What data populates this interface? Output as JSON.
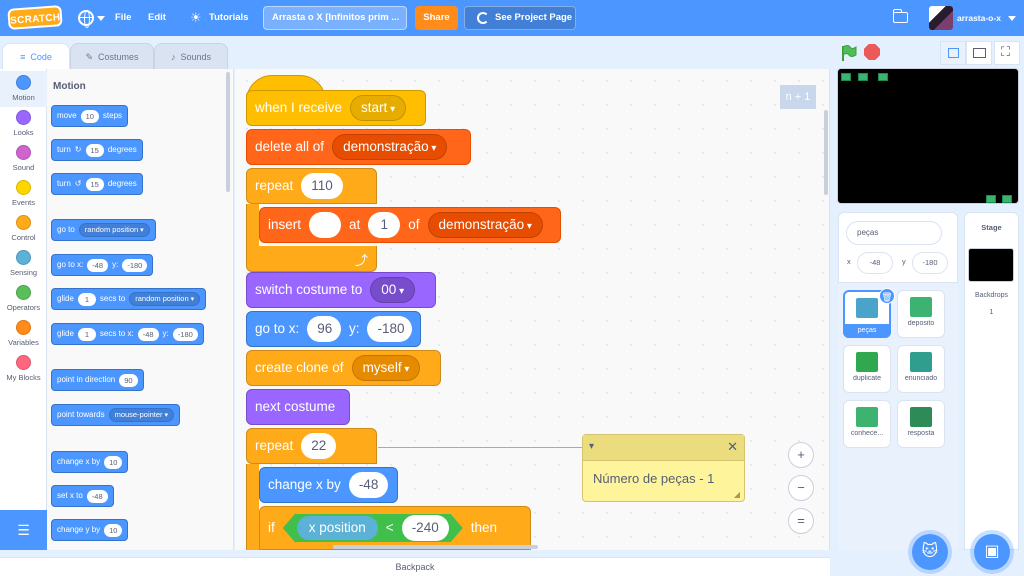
{
  "menubar": {
    "logo": "SCRATCH",
    "file": "File",
    "edit": "Edit",
    "tutorials": "Tutorials",
    "project_title": "Arrasta o X [Infinitos prim ...",
    "share": "Share",
    "see_project_page": "See Project Page",
    "username": "arrasta-o-x"
  },
  "tabs": {
    "code": "Code",
    "costumes": "Costumes",
    "sounds": "Sounds"
  },
  "categories": [
    {
      "label": "Motion",
      "color": "#4c97ff"
    },
    {
      "label": "Looks",
      "color": "#9966ff"
    },
    {
      "label": "Sound",
      "color": "#cf63cf"
    },
    {
      "label": "Events",
      "color": "#ffd500"
    },
    {
      "label": "Control",
      "color": "#ffab19"
    },
    {
      "label": "Sensing",
      "color": "#5cb1d6"
    },
    {
      "label": "Operators",
      "color": "#59c059"
    },
    {
      "label": "Variables",
      "color": "#ff8c1a"
    },
    {
      "label": "My Blocks",
      "color": "#ff6680"
    }
  ],
  "flyout": {
    "title": "Motion",
    "move": {
      "a": "move",
      "v": "10",
      "b": "steps"
    },
    "turn_right": {
      "a": "turn",
      "v": "15",
      "b": "degrees"
    },
    "turn_left": {
      "a": "turn",
      "v": "15",
      "b": "degrees"
    },
    "goto": {
      "a": "go to",
      "dd": "random position"
    },
    "goto_xy": {
      "a": "go to x:",
      "x": "-48",
      "b": "y:",
      "y": "-180"
    },
    "glide_to": {
      "a": "glide",
      "v": "1",
      "b": "secs to",
      "dd": "random position"
    },
    "glide_xy": {
      "a": "glide",
      "v": "1",
      "b": "secs to x:",
      "x": "-48",
      "c": "y:",
      "y": "-180"
    },
    "point_dir": {
      "a": "point in direction",
      "v": "90"
    },
    "point_towards": {
      "a": "point towards",
      "dd": "mouse-pointer"
    },
    "change_x": {
      "a": "change x by",
      "v": "10"
    },
    "set_x": {
      "a": "set x to",
      "v": "-48"
    },
    "change_y": {
      "a": "change y by",
      "v": "10"
    }
  },
  "script": {
    "when_receive": {
      "a": "when I receive",
      "dd": "start"
    },
    "delete_all": {
      "a": "delete all of",
      "dd": "demonstração"
    },
    "repeat1": {
      "a": "repeat",
      "v": "110"
    },
    "insert": {
      "a": "insert",
      "v1": "",
      "b": "at",
      "v2": "1",
      "c": "of",
      "dd": "demonstração"
    },
    "switch_costume": {
      "a": "switch costume to",
      "dd": "00"
    },
    "goto_xy": {
      "a": "go to x:",
      "x": "96",
      "b": "y:",
      "y": "-180"
    },
    "create_clone": {
      "a": "create clone of",
      "dd": "myself"
    },
    "next_costume": "next costume",
    "repeat2": {
      "a": "repeat",
      "v": "22"
    },
    "change_x": {
      "a": "change x by",
      "v": "-48"
    },
    "if_block": {
      "a": "if",
      "rep": "x position",
      "op": "<",
      "v": "-240",
      "b": "then"
    },
    "ghost_label": "n + 1"
  },
  "comment": {
    "text": "Número de peças - 1"
  },
  "zoom": {
    "in": "+",
    "out": "−",
    "reset": "="
  },
  "backpack": "Backpack",
  "sprite_info": {
    "name": "peças",
    "x_label": "x",
    "x": "-48",
    "y_label": "y",
    "y": "-180"
  },
  "sprites": [
    {
      "name": "peças",
      "color": "#4aa3c8"
    },
    {
      "name": "deposito",
      "color": "#3cb371"
    },
    {
      "name": "duplicate",
      "color": "#2fa84f"
    },
    {
      "name": "enunciado",
      "color": "#2f9e8f"
    },
    {
      "name": "conhece...",
      "color": "#3cb371"
    },
    {
      "name": "resposta",
      "color": "#2e8b57"
    }
  ],
  "stage_panel": {
    "title": "Stage",
    "backdrops_label": "Backdrops",
    "backdrops_count": "1"
  }
}
